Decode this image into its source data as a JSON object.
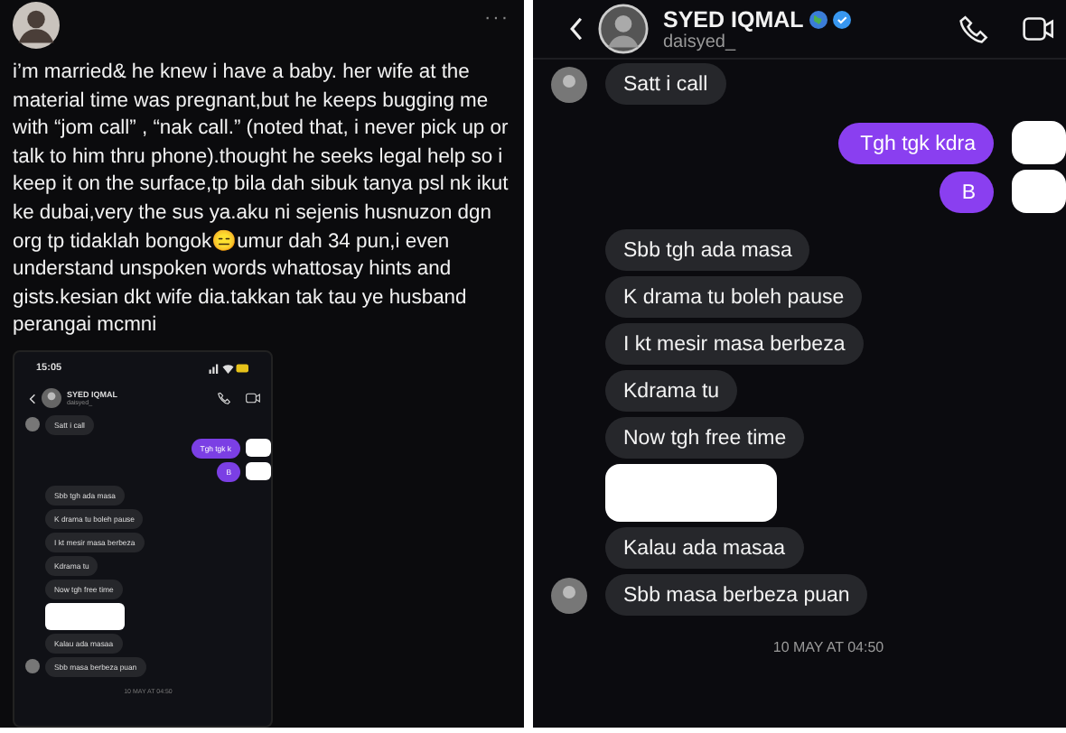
{
  "post": {
    "menu": "···",
    "body": "i’m married& he knew i have a baby. her wife at the material time was pregnant,but he keeps bugging me with “jom call” , “nak call.” (noted that, i never pick up or talk to him thru phone).thought he seeks legal help so i keep it on the surface,tp bila dah sibuk tanya psl nk ikut ke dubai,very the sus ya.aku ni sejenis husnuzon dgn org tp tidaklah bongok😑umur dah 34 pun,i even understand unspoken words whattosay hints and gists.kesian dkt wife dia.takkan tak tau ye husband perangai mcmni",
    "screenshot": {
      "time": "15:05",
      "contact": {
        "name": "SYED IQMAL",
        "handle": "daisyed_"
      },
      "messages": [
        {
          "kind": "incoming",
          "text": "Satt i call",
          "avatar": true
        },
        {
          "kind": "outgoing",
          "text": "Tgh tgk k"
        },
        {
          "kind": "outgoing",
          "text": "B"
        },
        {
          "kind": "incoming",
          "text": "Sbb tgh ada masa",
          "avatar": false
        },
        {
          "kind": "incoming",
          "text": "K drama tu boleh pause",
          "avatar": false
        },
        {
          "kind": "incoming",
          "text": "I kt mesir masa berbeza",
          "avatar": false
        },
        {
          "kind": "incoming",
          "text": "Kdrama tu",
          "avatar": false
        },
        {
          "kind": "incoming",
          "text": "Now tgh free time",
          "avatar": false
        },
        {
          "kind": "redacted"
        },
        {
          "kind": "incoming",
          "text": "Kalau ada masaa",
          "avatar": false
        },
        {
          "kind": "incoming",
          "text": "Sbb masa berbeza puan",
          "avatar": true
        }
      ],
      "timestamp": "10 MAY AT 04:50"
    }
  },
  "chat": {
    "contact": {
      "name": "SYED IQMAL",
      "handle": "daisyed_"
    },
    "messages": [
      {
        "kind": "incoming",
        "text": "Satt i call",
        "avatar": true
      },
      {
        "kind": "outgoing",
        "text": "Tgh tgk kdra"
      },
      {
        "kind": "outgoing",
        "text": "B"
      },
      {
        "kind": "incoming",
        "text": "Sbb tgh ada masa",
        "avatar": false
      },
      {
        "kind": "incoming",
        "text": "K drama tu boleh pause",
        "avatar": false
      },
      {
        "kind": "incoming",
        "text": "I kt mesir masa berbeza",
        "avatar": false
      },
      {
        "kind": "incoming",
        "text": "Kdrama tu",
        "avatar": false
      },
      {
        "kind": "incoming",
        "text": "Now tgh free time",
        "avatar": false
      },
      {
        "kind": "redacted"
      },
      {
        "kind": "incoming",
        "text": "Kalau ada masaa",
        "avatar": false
      },
      {
        "kind": "incoming",
        "text": "Sbb masa berbeza puan",
        "avatar": true
      }
    ],
    "timestamp": "10 MAY AT 04:50"
  }
}
